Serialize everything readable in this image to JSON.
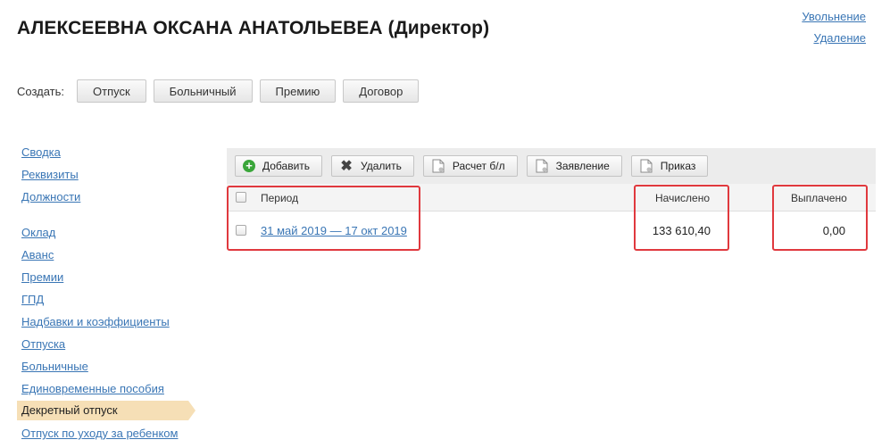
{
  "header": {
    "title": "АЛЕКСЕЕВНА ОКСАНА АНАТОЛЬЕВЕА (Директор)",
    "links": [
      "Увольнение",
      "Удаление"
    ]
  },
  "create": {
    "label": "Создать:",
    "buttons": [
      "Отпуск",
      "Больничный",
      "Премию",
      "Договор"
    ]
  },
  "sidebar": {
    "group1": [
      "Сводка",
      "Реквизиты",
      "Должности"
    ],
    "group2": [
      "Оклад",
      "Аванс",
      "Премии",
      "ГПД",
      "Надбавки и коэффициенты",
      "Отпуска",
      "Больничные",
      "Единовременные пособия"
    ],
    "active": "Декретный отпуск",
    "after": [
      "Отпуск по уходу за ребенком"
    ]
  },
  "toolbar": {
    "add": "Добавить",
    "delete": "Удалить",
    "calc": "Расчет б/л",
    "application": "Заявление",
    "order": "Приказ"
  },
  "table": {
    "headers": {
      "period": "Период",
      "accrued": "Начислено",
      "paid": "Выплачено"
    },
    "rows": [
      {
        "period": "31 май 2019 — 17 окт 2019",
        "accrued": "133 610,40",
        "paid": "0,00"
      }
    ]
  },
  "colors": {
    "link": "#3a76b5",
    "highlight": "#e0393e",
    "active_nav": "#f6dfb6",
    "toolbar_bg": "#ececec",
    "add_icon": "#3aa63a"
  }
}
